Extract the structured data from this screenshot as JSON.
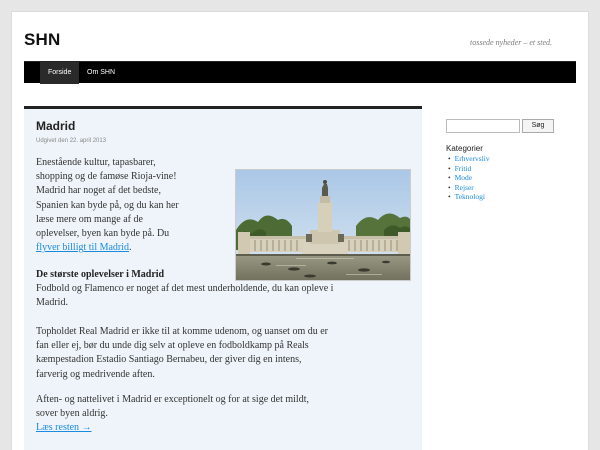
{
  "header": {
    "site_title": "SHN",
    "site_description": "tossede nyheder – et sted."
  },
  "nav": {
    "items": [
      {
        "label": "Forside",
        "active": true
      },
      {
        "label": "Om SHN",
        "active": false
      }
    ]
  },
  "post": {
    "title": "Madrid",
    "meta": "Udgivet den 22. april 2013",
    "intro_text": "Enestående kultur, tapasbarer,\nshopping og de famøse Rioja-vine!\nMadrid har noget af det bedste,\nSpanien kan byde på, og du kan her\nlæse mere om mange af de\noplevelser, byen kan byde på. Du",
    "intro_link": "flyver billigt til Madrid",
    "intro_link_suffix": ".",
    "heading": "De største oplevelser i Madrid",
    "paragraph_1": "Fodbold og Flamenco er noget af det mest underholdende, du kan opleve i\nMadrid.",
    "paragraph_2": "Topholdet Real Madrid er ikke til at komme udenom, og uanset om du er\nfan eller ej, bør du unde dig selv at opleve en fodboldkamp på Reals\nkæmpestadion Estadio Santiago Bernabeu, der giver dig en intens,\nfarverig og medrivende aften.",
    "paragraph_3": "Aften- og nattelivet i Madrid er exceptionelt og for at sige det mildt,\nsover byen aldrig.",
    "read_more": "Læs resten →"
  },
  "sidebar": {
    "search_value": "",
    "search_button": "Søg",
    "widget_title": "Kategorier",
    "categories": [
      "Erhvervsliv",
      "Fritid",
      "Mode",
      "Rejser",
      "Teknologi"
    ]
  },
  "colors": {
    "link": "#1b8be0",
    "nav_bg": "#000000",
    "content_bg": "#eef4f9"
  }
}
